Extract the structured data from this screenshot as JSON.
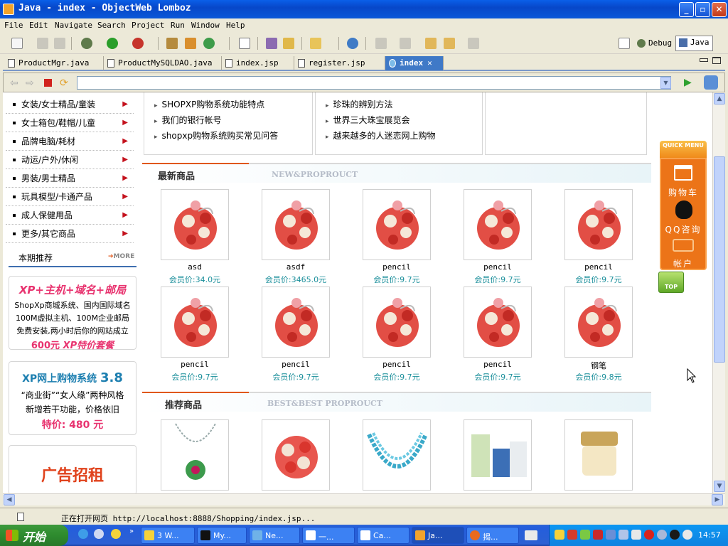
{
  "window": {
    "title": "Java - index - ObjectWeb Lomboz"
  },
  "menu": [
    "File",
    "Edit",
    "Navigate",
    "Search",
    "Project",
    "Run",
    "Window",
    "Help"
  ],
  "perspectives": {
    "debug": "Debug",
    "java": "Java"
  },
  "tabs": [
    "ProductMgr.java",
    "ProductMySQLDAO.java",
    "index.jsp",
    "register.jsp",
    "index"
  ],
  "sidebar": {
    "categories": [
      "女装/女士精品/童装",
      "女士箱包/鞋帽/儿童",
      "品牌电脑/耗材",
      "动运/户外/休闲",
      "男装/男士精品",
      "玩具模型/卡通产品",
      "成人保健用品",
      "更多/其它商品"
    ],
    "featured_title": "本期推荐",
    "more": "MORE",
    "ad1": {
      "headline": "XP+主机+域名+邮局",
      "line1": "ShopXp商城系统、国内国际域名",
      "line2": "100M虚拟主机、100M企业邮局",
      "line3": "免费安装,两小时后你的网站成立",
      "price": "600元",
      "package": "XP特价套餐"
    },
    "ad2": {
      "headline": "XP网上购物系统",
      "version": "3.8",
      "line1": "“商业街”“女人缘”两种风格",
      "line2": "新增若干功能，价格依旧",
      "price": "特价: 480 元"
    },
    "ad3": {
      "headline": "广告招租"
    }
  },
  "news": {
    "col1": [
      "SHOPXP购物系统功能特点",
      "我们的银行帐号",
      "shopxp购物系统购买常见问答"
    ],
    "col2": [
      "珍珠的辨别方法",
      "世界三大珠宝展览会",
      "越来越多的人迷恋网上购物"
    ]
  },
  "newest": {
    "title": "最新商品",
    "english": "NEW&PROPROUCT",
    "items": [
      {
        "name": "asd",
        "price": "会员价:34.0元"
      },
      {
        "name": "asdf",
        "price": "会员价:3465.0元"
      },
      {
        "name": "pencil",
        "price": "会员价:9.7元"
      },
      {
        "name": "pencil",
        "price": "会员价:9.7元"
      },
      {
        "name": "pencil",
        "price": "会员价:9.7元"
      },
      {
        "name": "pencil",
        "price": "会员价:9.7元"
      },
      {
        "name": "pencil",
        "price": "会员价:9.7元"
      },
      {
        "name": "pencil",
        "price": "会员价:9.7元"
      },
      {
        "name": "pencil",
        "price": "会员价:9.7元"
      },
      {
        "name": "钢笔",
        "price": "会员价:9.8元"
      }
    ]
  },
  "recommended": {
    "title": "推荐商品",
    "english": "BEST&BEST PROPROUCT"
  },
  "quickmenu": {
    "header": "QUICK MENU",
    "cart": "购物车",
    "qq": "QQ咨询",
    "account": "帐户",
    "top": "TOP"
  },
  "status": {
    "text": "正在打开网页 http://localhost:8888/Shopping/index.jsp..."
  },
  "taskbar": {
    "start": "开始",
    "tasks": [
      "3 W...",
      "My...",
      "Ne...",
      "一...",
      "Ca...",
      "Ja...",
      "揭..."
    ],
    "clock": "14:57"
  }
}
